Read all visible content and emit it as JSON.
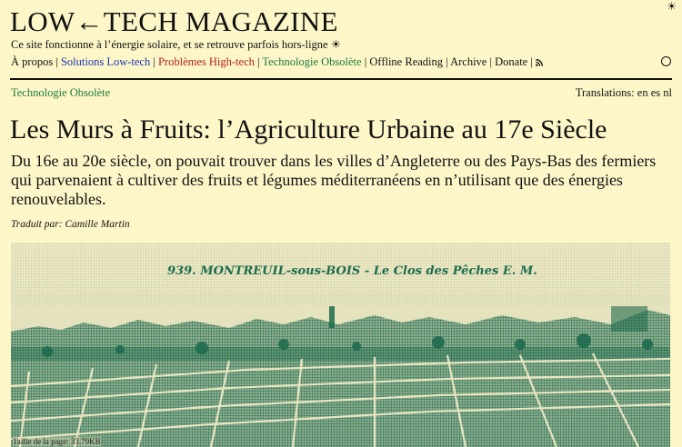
{
  "site": {
    "title": "LOW←TECH MAGAZINE",
    "tagline": "Ce site fonctionne à l’énergie solaire, et se retrouve parfois hors-ligne ☀",
    "sun_symbol": "☀"
  },
  "nav": {
    "items": [
      {
        "label": "À propos",
        "color": "#111111"
      },
      {
        "label": "Solutions Low-tech",
        "color": "#1b35b8"
      },
      {
        "label": "Problèmes High-tech",
        "color": "#b81d1d"
      },
      {
        "label": "Technologie Obsolète",
        "color": "#1f7a3c"
      },
      {
        "label": "Offline Reading",
        "color": "#111111"
      },
      {
        "label": "Archive",
        "color": "#111111"
      },
      {
        "label": "Donate",
        "color": "#111111"
      }
    ],
    "separator": "|",
    "rss_icon": "rss-icon",
    "toggle_icon": "circle-icon"
  },
  "article": {
    "category": "Technologie Obsolète",
    "translations_label": "Translations:",
    "translations": [
      "en",
      "es",
      "nl"
    ],
    "title": "Les Murs à Fruits: l’Agriculture Urbaine au 17e Siècle",
    "lede": "Du 16e au 20e siècle, on pouvait trouver dans les villes d’Angleterre ou des Pays-Bas des fermiers qui parvenaient à cultiver des fruits et légumes méditerranéens en n’utilisant que des énergies renouvelables.",
    "byline_label": "Traduit par:",
    "byline_name": "Camille Martin"
  },
  "figure": {
    "postcard_text": "939. MONTREUIL-sous-BOIS - Le Clos des Pêches  E. M.",
    "caption": "Taille de la page: 33.79KB"
  },
  "colors": {
    "background": "#fdf6c8",
    "link_blue": "#1b35b8",
    "link_red": "#b81d1d",
    "link_green": "#1f7a3c",
    "duotone_green": "#1f6b4e"
  }
}
